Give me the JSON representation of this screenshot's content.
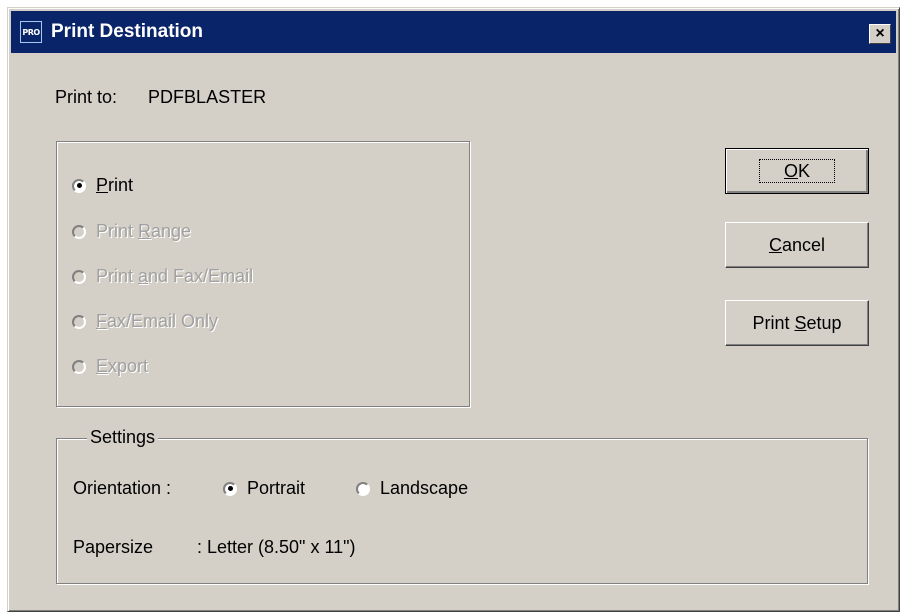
{
  "window": {
    "title": "Print Destination",
    "app_icon_text": "PRO",
    "close_label": "×"
  },
  "print_to": {
    "label": "Print to:",
    "value": "PDFBLASTER"
  },
  "print_options": [
    {
      "label": "Print",
      "selected": true,
      "enabled": true
    },
    {
      "label": "Print Range",
      "selected": false,
      "enabled": false
    },
    {
      "label": "Print and Fax/Email",
      "selected": false,
      "enabled": false
    },
    {
      "label": "Fax/Email Only",
      "selected": false,
      "enabled": false
    },
    {
      "label": "Export",
      "selected": false,
      "enabled": false
    }
  ],
  "buttons": {
    "ok": "OK",
    "cancel": "Cancel",
    "print_setup": "Print Setup"
  },
  "settings": {
    "legend": "Settings",
    "orientation_label": "Orientation :",
    "orientation_options": [
      {
        "label": "Portrait",
        "selected": true
      },
      {
        "label": "Landscape",
        "selected": false
      }
    ],
    "papersize_label": "Papersize",
    "papersize_value": ": Letter (8.50\" x 11\")"
  },
  "colors": {
    "titlebar": "#0a246a",
    "face": "#d4d0c8",
    "disabled_text": "#a0a0a0"
  }
}
